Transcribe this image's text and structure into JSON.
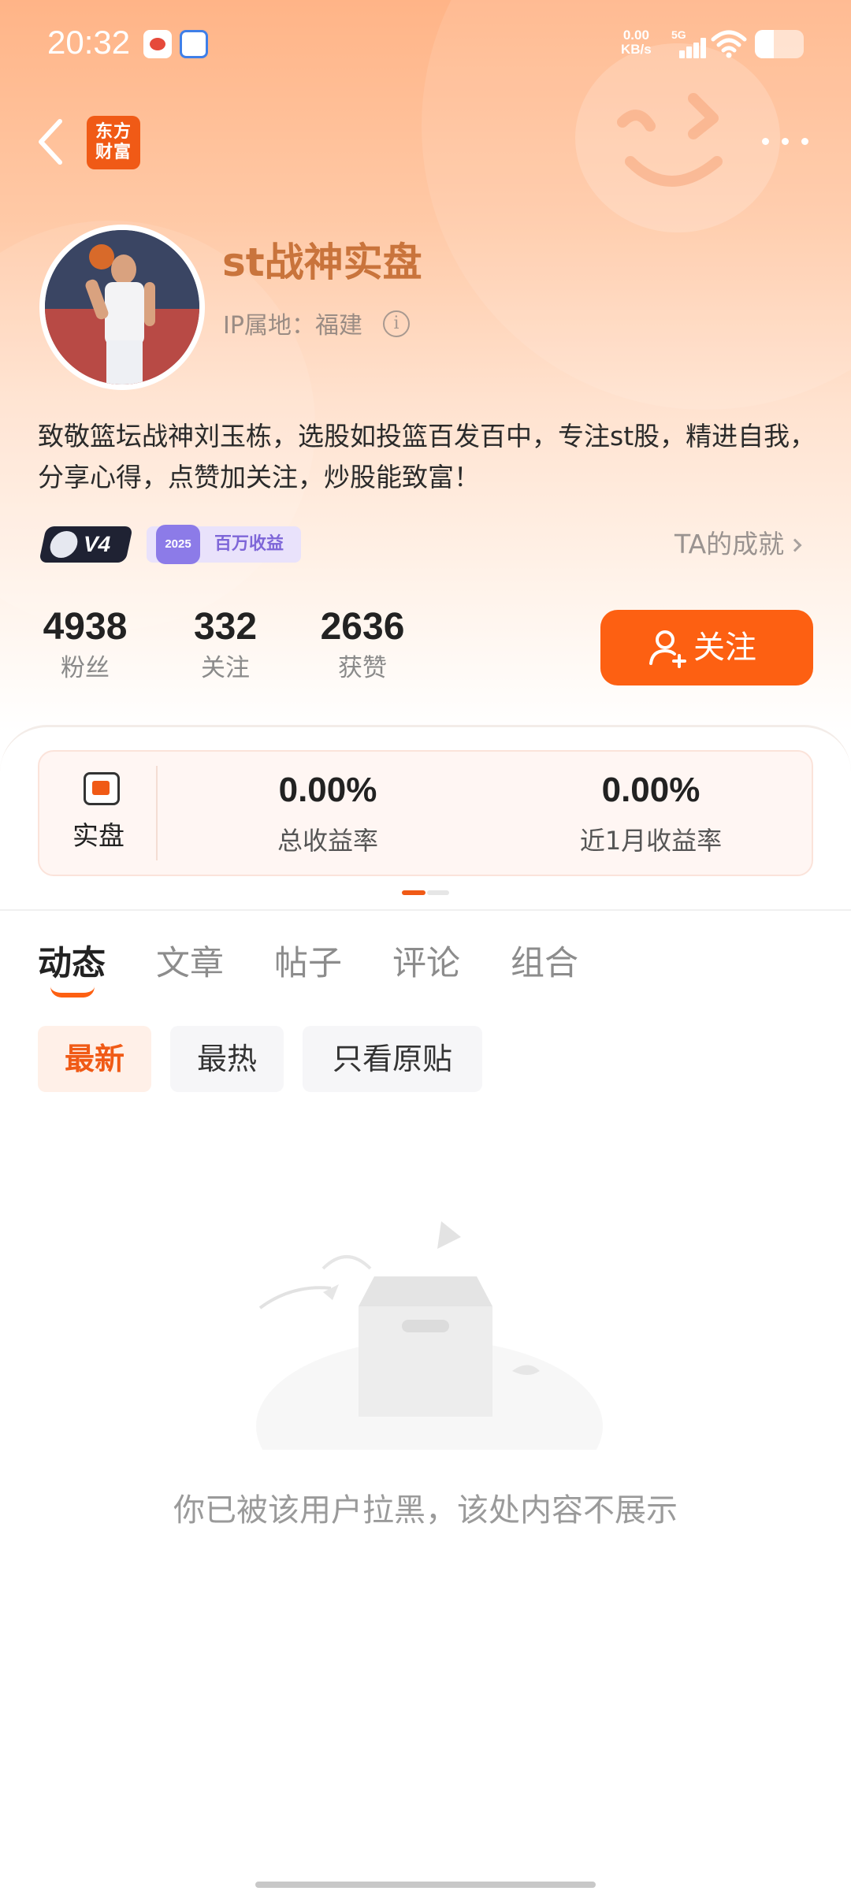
{
  "status_bar": {
    "time": "20:32",
    "net_speed": "0.00",
    "net_unit": "KB/s",
    "signal_type": "5G",
    "apps": [
      "weibo-icon",
      "app-icon"
    ]
  },
  "nav": {
    "brand_line1": "东方",
    "brand_line2": "财富"
  },
  "profile": {
    "username": "st战神实盘",
    "ip_location": "IP属地：福建",
    "bio": "致敬篮坛战神刘玉栋，选股如投篮百发百中，专注st股，精进自我，分享心得，点赞加关注，炒股能致富！",
    "level_badge": "V4",
    "award_year": "2025",
    "award_label": "百万收益",
    "achievements_link": "TA的成就"
  },
  "stats": [
    {
      "value": "4938",
      "label": "粉丝"
    },
    {
      "value": "332",
      "label": "关注"
    },
    {
      "value": "2636",
      "label": "获赞"
    }
  ],
  "follow_button": "关注",
  "performance": {
    "label": "实盘",
    "total_return": "0.00%",
    "total_return_label": "总收益率",
    "month_return": "0.00%",
    "month_return_label": "近1月收益率"
  },
  "tabs": [
    "动态",
    "文章",
    "帖子",
    "评论",
    "组合"
  ],
  "filters": [
    "最新",
    "最热",
    "只看原贴"
  ],
  "empty_message": "你已被该用户拉黑，该处内容不展示",
  "colors": {
    "accent": "#fd6012",
    "username": "#c9743c"
  }
}
